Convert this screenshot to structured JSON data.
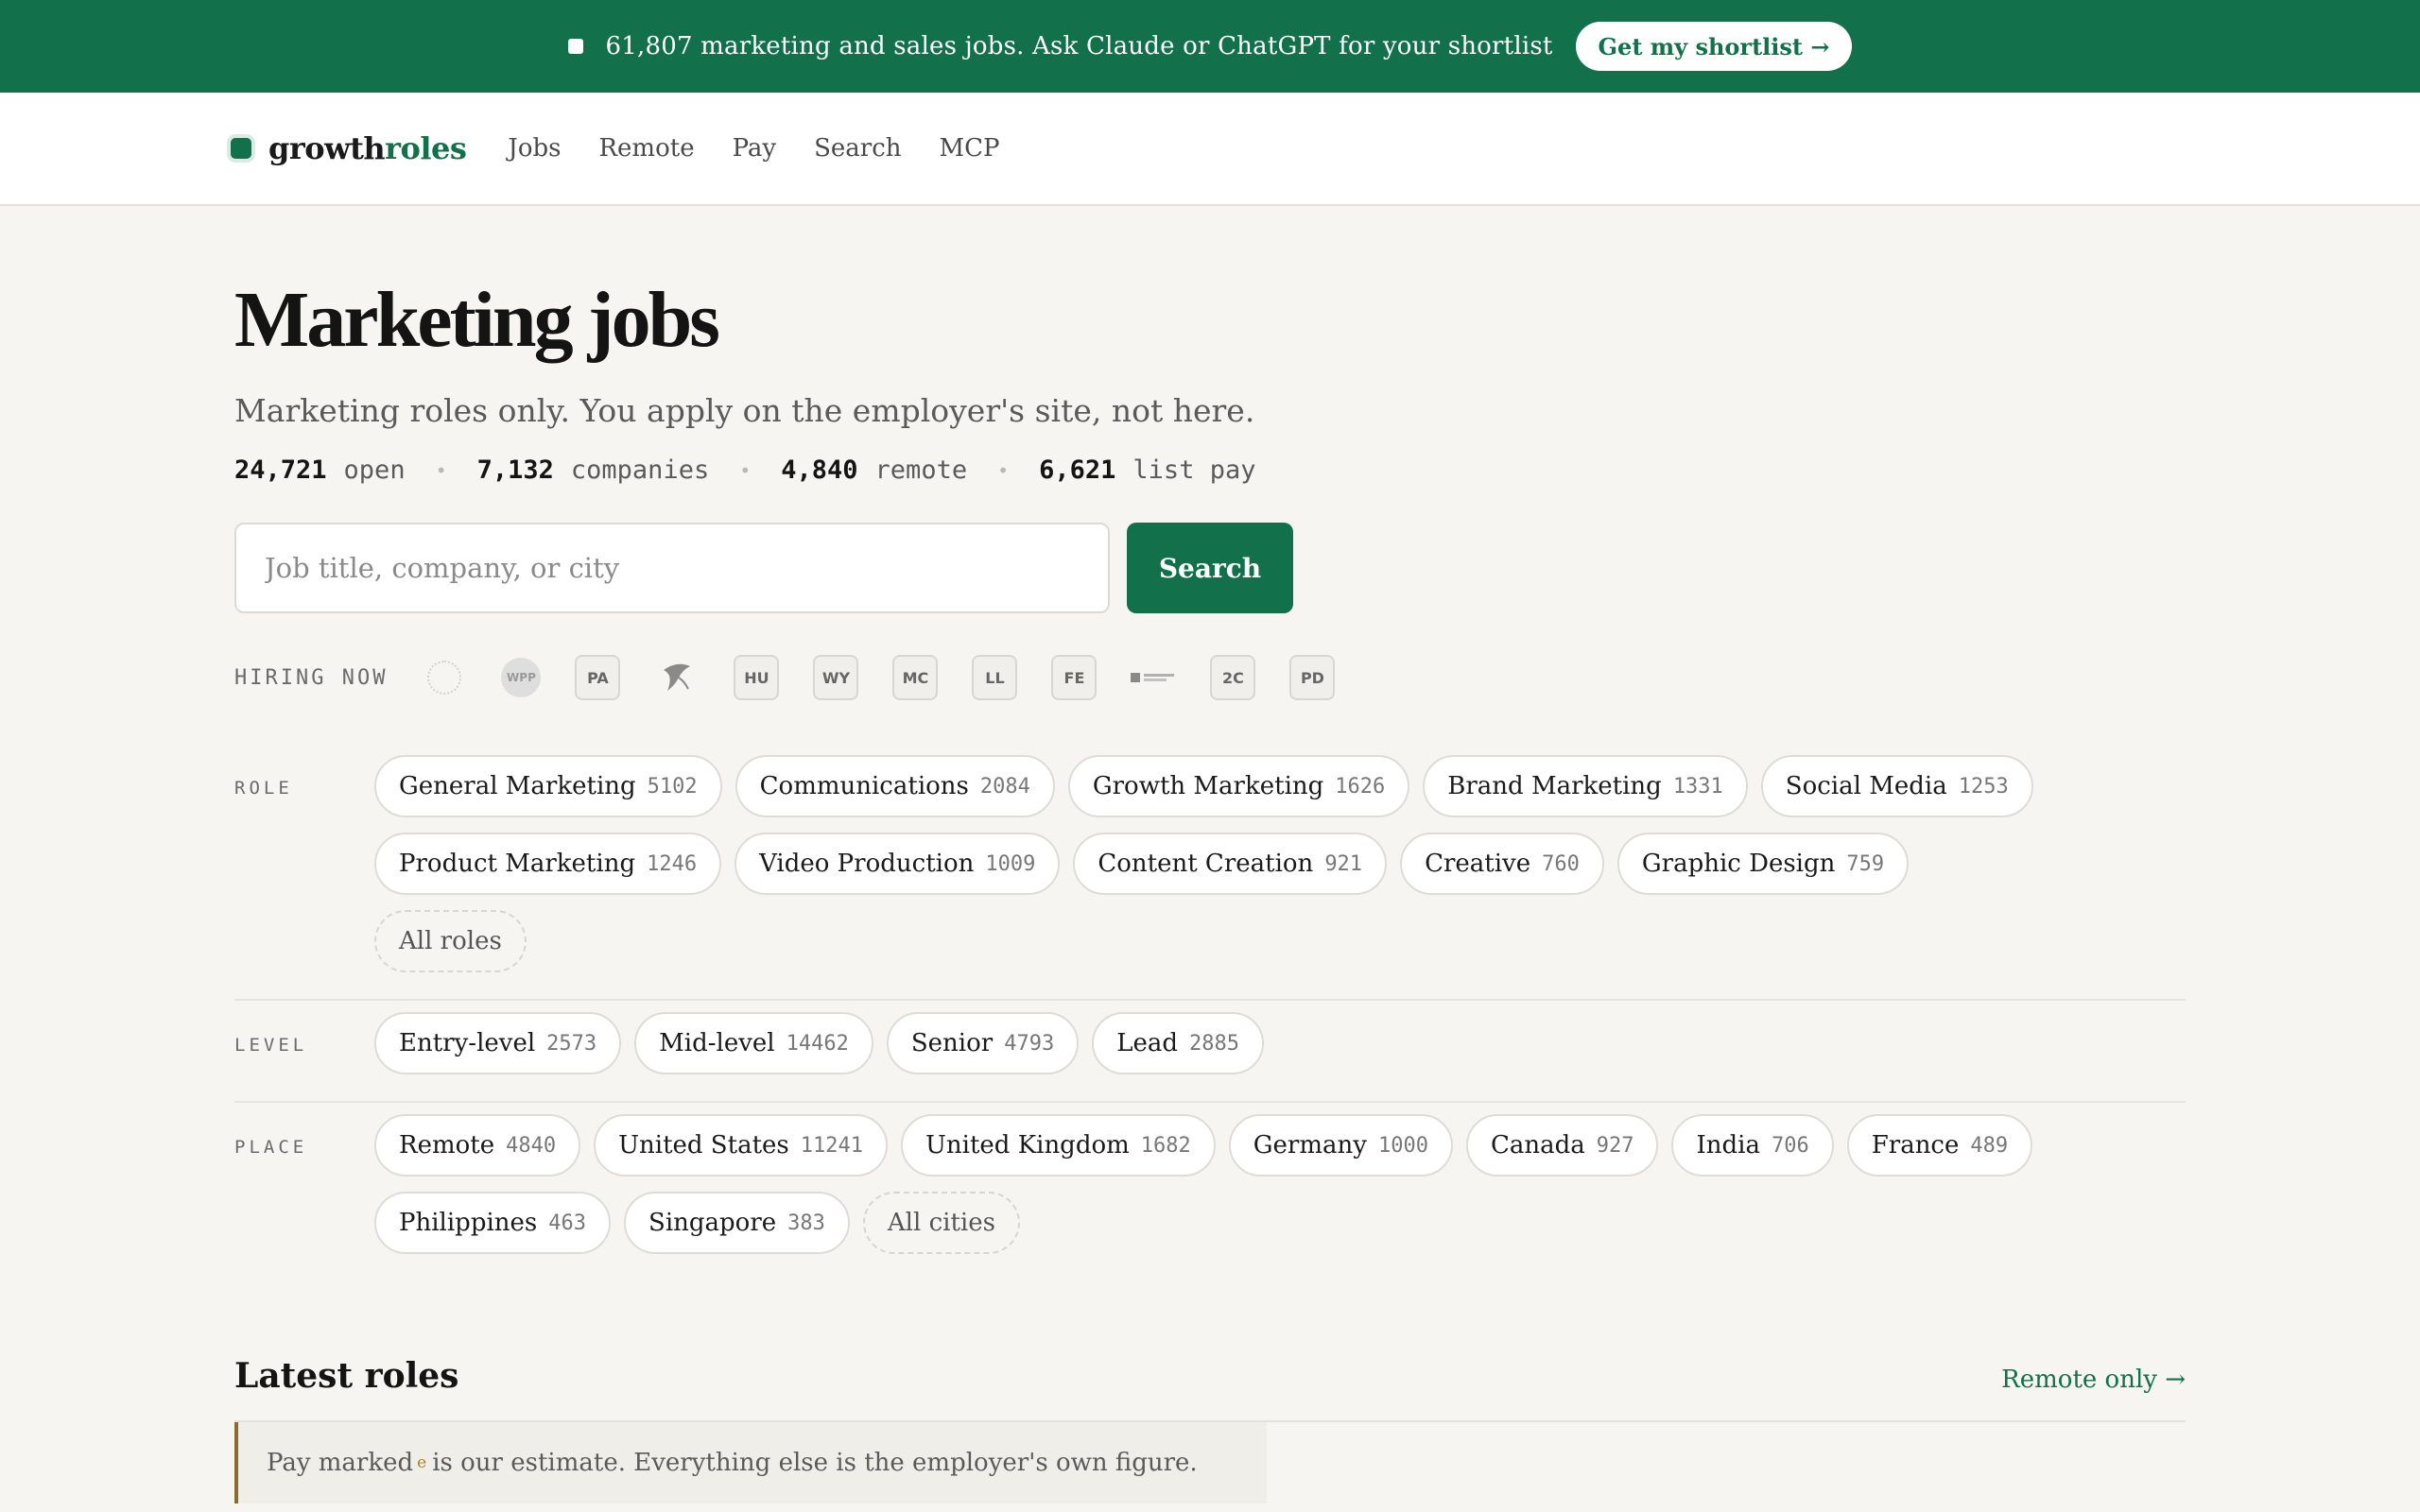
{
  "banner": {
    "message": "61,807 marketing and sales jobs. Ask Claude or ChatGPT for your shortlist",
    "cta": "Get my shortlist →"
  },
  "nav": {
    "logo_part1": "growth",
    "logo_part2": "roles",
    "links": [
      "Jobs",
      "Remote",
      "Pay",
      "Search",
      "MCP"
    ]
  },
  "page": {
    "title": "Marketing jobs",
    "subtitle": "Marketing roles only. You apply on the employer's site, not here."
  },
  "stats": [
    {
      "value": "24,721",
      "label": "open"
    },
    {
      "value": "7,132",
      "label": "companies"
    },
    {
      "value": "4,840",
      "label": "remote"
    },
    {
      "value": "6,621",
      "label": "list pay"
    }
  ],
  "search": {
    "placeholder": "Job title, company, or city",
    "button": "Search"
  },
  "hiring": {
    "label": "HIRING NOW",
    "logos": [
      "PA",
      "HU",
      "WY",
      "MC",
      "LL",
      "FE",
      "2C",
      "PD"
    ],
    "circle_logo_text": "WPP"
  },
  "filters": {
    "role": {
      "label": "ROLE",
      "chips": [
        {
          "name": "General Marketing",
          "count": "5102"
        },
        {
          "name": "Communications",
          "count": "2084"
        },
        {
          "name": "Growth Marketing",
          "count": "1626"
        },
        {
          "name": "Brand Marketing",
          "count": "1331"
        },
        {
          "name": "Social Media",
          "count": "1253"
        },
        {
          "name": "Product Marketing",
          "count": "1246"
        },
        {
          "name": "Video Production",
          "count": "1009"
        },
        {
          "name": "Content Creation",
          "count": "921"
        },
        {
          "name": "Creative",
          "count": "760"
        },
        {
          "name": "Graphic Design",
          "count": "759"
        }
      ],
      "all": "All roles"
    },
    "level": {
      "label": "LEVEL",
      "chips": [
        {
          "name": "Entry-level",
          "count": "2573"
        },
        {
          "name": "Mid-level",
          "count": "14462"
        },
        {
          "name": "Senior",
          "count": "4793"
        },
        {
          "name": "Lead",
          "count": "2885"
        }
      ]
    },
    "place": {
      "label": "PLACE",
      "chips": [
        {
          "name": "Remote",
          "count": "4840"
        },
        {
          "name": "United States",
          "count": "11241"
        },
        {
          "name": "United Kingdom",
          "count": "1682"
        },
        {
          "name": "Germany",
          "count": "1000"
        },
        {
          "name": "Canada",
          "count": "927"
        },
        {
          "name": "India",
          "count": "706"
        },
        {
          "name": "France",
          "count": "489"
        },
        {
          "name": "Philippines",
          "count": "463"
        },
        {
          "name": "Singapore",
          "count": "383"
        }
      ],
      "all": "All cities"
    }
  },
  "latest": {
    "title": "Latest roles",
    "remote_link": "Remote only →"
  },
  "note": {
    "before": "Pay marked",
    "marker": "e",
    "after": "is our estimate. Everything else is the employer's own figure."
  }
}
